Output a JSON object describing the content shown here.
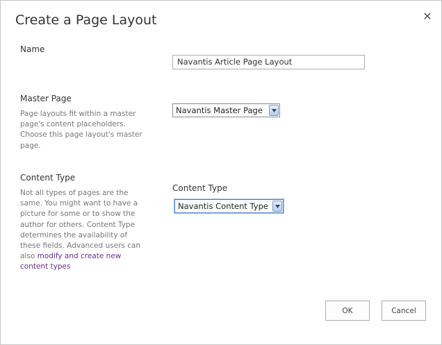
{
  "dialog": {
    "title": "Create a Page Layout",
    "close_glyph": "✕",
    "close_icon": "close-icon"
  },
  "name_section": {
    "label": "Name",
    "value": "Navantis Article Page Layout"
  },
  "master_page_section": {
    "label": "Master Page",
    "description": "Page layouts fit within a master page's content placeholders. Choose this page layout's master page.",
    "selected": "Navantis Master Page"
  },
  "content_type_section": {
    "label": "Content Type",
    "description": "Not all types of pages are the same. You might want to have a picture for some or to show the author for others. Content Type determines the availability of these fields. Advanced users can also ",
    "link_text": "modify and create new content types",
    "field_label": "Content Type",
    "selected": "Navantis Content Type"
  },
  "buttons": {
    "ok_label": "OK",
    "cancel_label": "Cancel"
  },
  "colors": {
    "link": "#6a2c91",
    "focus_border": "#4c86c6"
  }
}
